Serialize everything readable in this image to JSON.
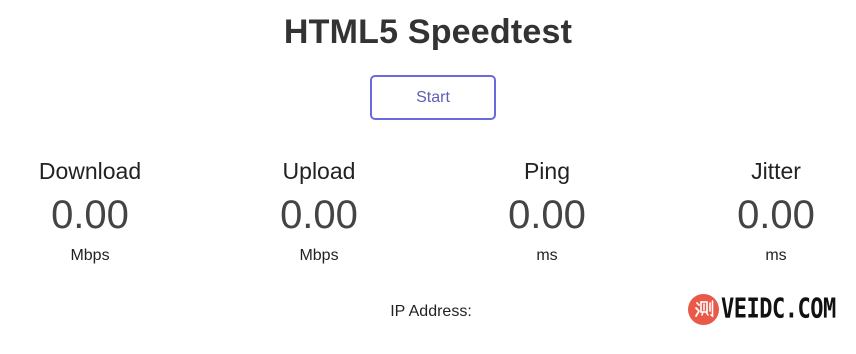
{
  "header": {
    "title": "HTML5 Speedtest"
  },
  "controls": {
    "start_label": "Start"
  },
  "metrics": [
    {
      "label": "Download",
      "value": "0.00",
      "unit": "Mbps"
    },
    {
      "label": "Upload",
      "value": "0.00",
      "unit": "Mbps"
    },
    {
      "label": "Ping",
      "value": "0.00",
      "unit": "ms"
    },
    {
      "label": "Jitter",
      "value": "0.00",
      "unit": "ms"
    }
  ],
  "ip": {
    "label": "IP Address:",
    "value": ""
  },
  "watermark": {
    "text": "VEIDC.COM",
    "badge_glyph": "测",
    "badge_color": "#e9594a"
  },
  "colors": {
    "accent": "#6a6ae0",
    "text": "#333333"
  }
}
